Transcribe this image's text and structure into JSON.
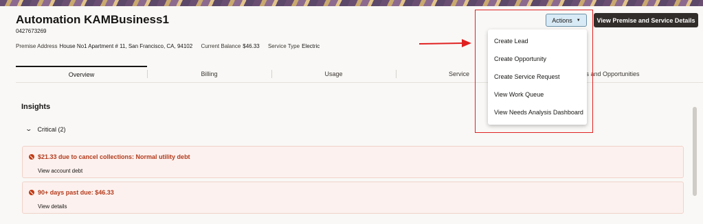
{
  "header": {
    "title": "Automation KAMBusiness1",
    "account_number": "0427673269",
    "premise_label": "Premise Address",
    "premise_value": "House No1 Apartment # 11, San Francisco, CA, 94102",
    "balance_label": "Current Balance",
    "balance_value": "$46.33",
    "service_type_label": "Service Type",
    "service_type_value": "Electric",
    "actions_label": "Actions",
    "view_details_label": "View Premise and Service Details"
  },
  "tabs": [
    "Overview",
    "Billing",
    "Usage",
    "Service",
    "ds and Opportunities"
  ],
  "insights": {
    "heading": "Insights",
    "critical_label": "Critical (2)",
    "cards": [
      {
        "title": "$21.33 due to cancel collections: Normal utility debt",
        "link": "View account debt"
      },
      {
        "title": "90+ days past due: $46.33",
        "link": "View details"
      }
    ]
  },
  "actions_menu": {
    "items": [
      "Create Lead",
      "Create Opportunity",
      "Create Service Request",
      "View Work Queue",
      "View Needs Analysis Dashboard"
    ]
  },
  "colors": {
    "error": "#b33a1c",
    "highlight": "#e02020",
    "primary_button": "#312d2a",
    "actions_button": "#d8eaf5"
  }
}
